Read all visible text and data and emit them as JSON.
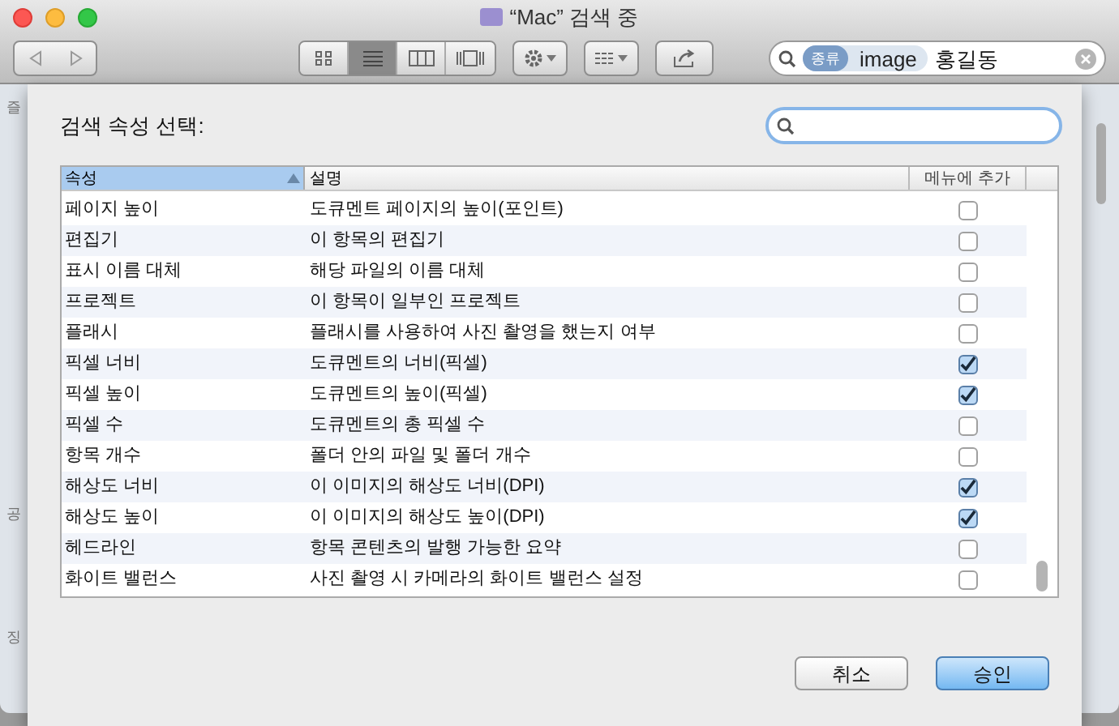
{
  "window": {
    "title": "“Mac” 검색 중"
  },
  "toolbar": {
    "view_modes": [
      {
        "selected": false
      },
      {
        "selected": true
      },
      {
        "selected": false
      },
      {
        "selected": false
      }
    ]
  },
  "search": {
    "token": "종류",
    "token_value": "image",
    "query": "홍길동"
  },
  "sidebar": {
    "headings": [
      "즐",
      "공",
      "징"
    ]
  },
  "sheet": {
    "prompt": "검색 속성 선택:",
    "columns": [
      "속성",
      "설명",
      "메뉴에 추가"
    ],
    "rows": [
      {
        "attribute": "페이지 높이",
        "description": "도큐멘트 페이지의 높이(포인트)",
        "checked": false
      },
      {
        "attribute": "편집기",
        "description": "이 항목의 편집기",
        "checked": false
      },
      {
        "attribute": "표시 이름 대체",
        "description": "해당 파일의 이름 대체",
        "checked": false
      },
      {
        "attribute": "프로젝트",
        "description": "이 항목이 일부인 프로젝트",
        "checked": false
      },
      {
        "attribute": "플래시",
        "description": "플래시를 사용하여 사진 촬영을 했는지 여부",
        "checked": false
      },
      {
        "attribute": "픽셀 너비",
        "description": "도큐멘트의 너비(픽셀)",
        "checked": true
      },
      {
        "attribute": "픽셀 높이",
        "description": "도큐멘트의 높이(픽셀)",
        "checked": true
      },
      {
        "attribute": "픽셀 수",
        "description": "도큐멘트의 총 픽셀 수",
        "checked": false
      },
      {
        "attribute": "항목 개수",
        "description": "폴더 안의 파일 및 폴더 개수",
        "checked": false
      },
      {
        "attribute": "해상도 너비",
        "description": "이 이미지의 해상도 너비(DPI)",
        "checked": true
      },
      {
        "attribute": "해상도 높이",
        "description": "이 이미지의 해상도 높이(DPI)",
        "checked": true
      },
      {
        "attribute": "헤드라인",
        "description": "항목 콘텐츠의 발행 가능한 요약",
        "checked": false
      },
      {
        "attribute": "화이트 밸런스",
        "description": "사진 촬영 시 카메라의 화이트 밸런스 설정",
        "checked": false
      }
    ],
    "buttons": [
      {
        "label": "취소",
        "kind": "cancel"
      },
      {
        "label": "승인",
        "kind": "default"
      }
    ]
  }
}
